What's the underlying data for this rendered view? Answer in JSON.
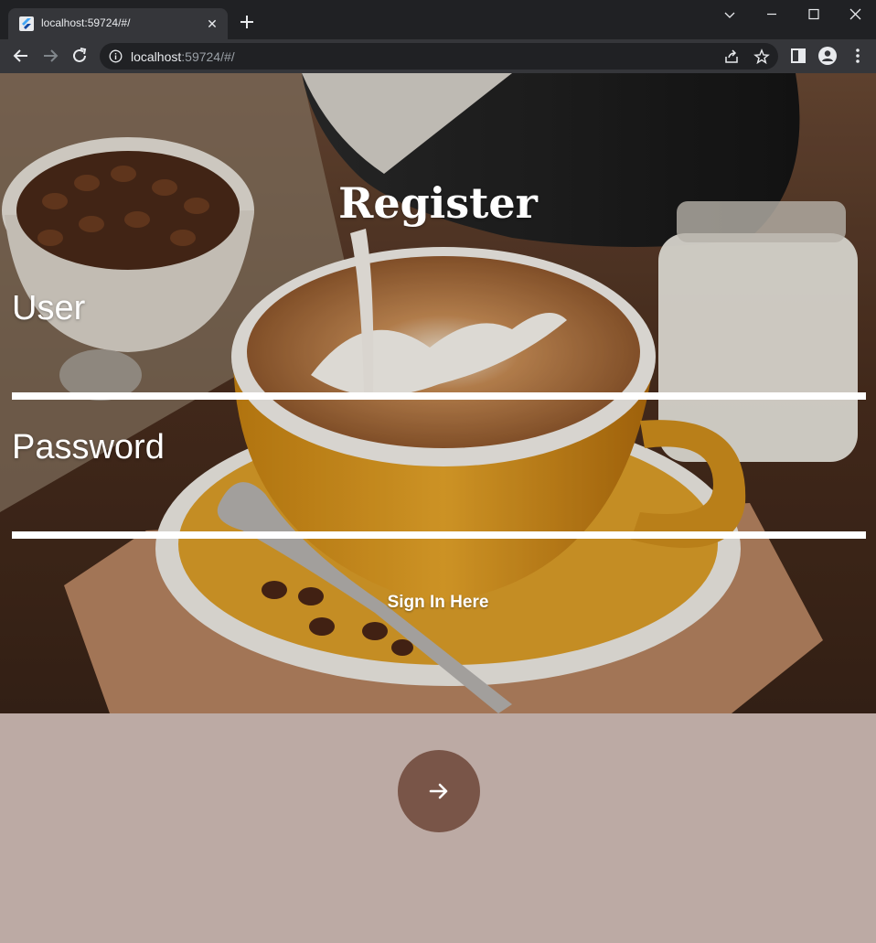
{
  "browser": {
    "tab_title": "localhost:59724/#/",
    "url_host": "localhost",
    "url_rest": ":59724/#/"
  },
  "form": {
    "title": "Register",
    "user_label": "User",
    "password_label": "Password",
    "sign_in_link": "Sign In Here"
  },
  "submit_button": {
    "icon": "arrow-forward-icon"
  },
  "colors": {
    "page_background": "#bcaaa4",
    "fab_background": "#795548",
    "text": "#ffffff"
  }
}
